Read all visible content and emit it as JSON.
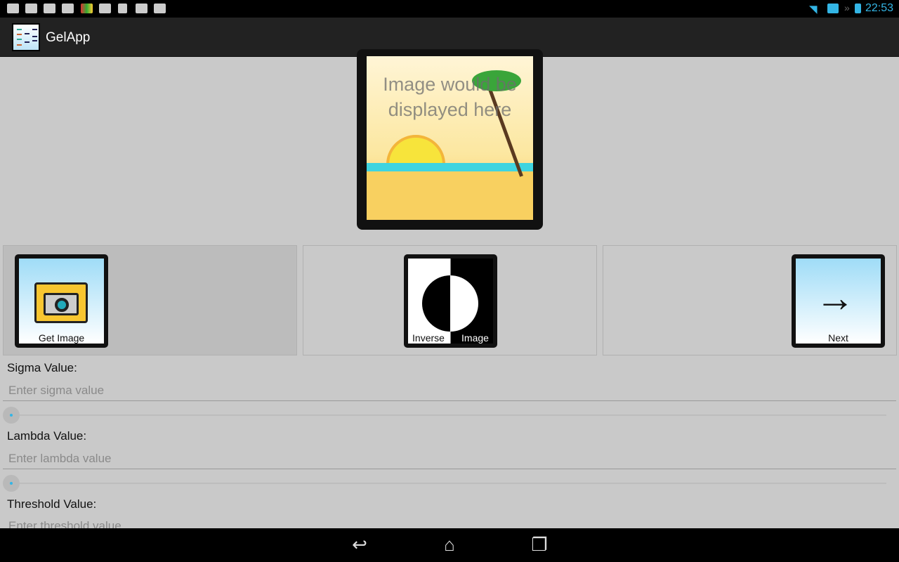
{
  "status_bar": {
    "time": "22:53",
    "left_icons": [
      "gallery-icon",
      "mail-icon",
      "mail-icon",
      "mail-icon",
      "app-icon",
      "download-icon",
      "sd-card-icon",
      "store-icon",
      "store-icon"
    ],
    "right_icons": [
      "wifi-icon",
      "keyboard-battery-icon",
      "battery-icon"
    ]
  },
  "action_bar": {
    "title": "GelApp"
  },
  "preview": {
    "placeholder": "Image would be displayed here"
  },
  "buttons": [
    {
      "label": "Get Image",
      "icon": "camera-folder-icon"
    },
    {
      "label_left": "Inverse",
      "label_right": "Image",
      "icon": "inverse-circle-icon"
    },
    {
      "label": "Next",
      "icon": "arrow-right-icon"
    }
  ],
  "fields": [
    {
      "label": "Sigma Value:",
      "placeholder": "Enter sigma value",
      "slider": 0
    },
    {
      "label": "Lambda Value:",
      "placeholder": "Enter lambda value",
      "slider": 0
    },
    {
      "label": "Threshold Value:",
      "placeholder": "Enter threshold value"
    }
  ],
  "colors": {
    "accent": "#33b5e5",
    "background": "#c9c9c9",
    "action_bar": "#222222"
  }
}
